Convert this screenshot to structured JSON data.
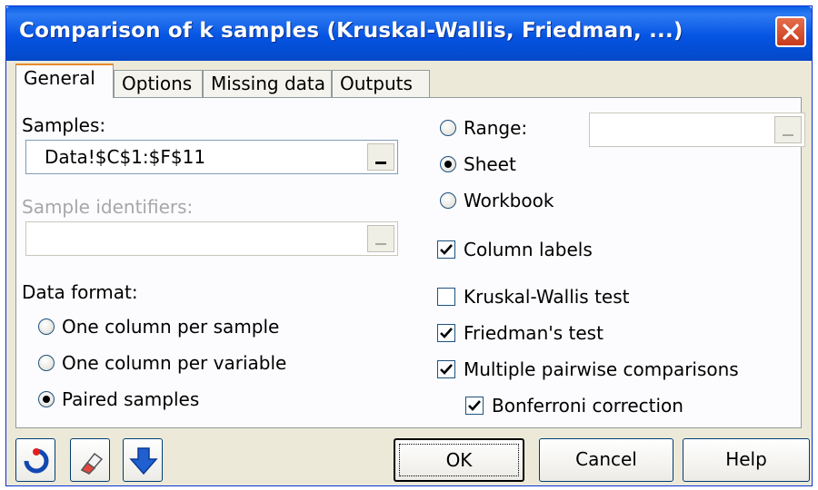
{
  "window": {
    "title": "Comparison of k samples (Kruskal-Wallis, Friedman, ...)"
  },
  "tabs": [
    "General",
    "Options",
    "Missing data",
    "Outputs"
  ],
  "general": {
    "samples_label": "Samples:",
    "samples_value": "Data!$C$1:$F$11",
    "sample_identifiers_label": "Sample identifiers:",
    "sample_identifiers_value": "",
    "data_format_label": "Data format:",
    "data_format_options": [
      "One column per sample",
      "One column per variable",
      "Paired samples"
    ],
    "data_format_selected": "Paired samples",
    "output_options": [
      "Range:",
      "Sheet",
      "Workbook"
    ],
    "output_selected": "Sheet",
    "range_value": "",
    "column_labels": {
      "label": "Column labels",
      "checked": true
    },
    "kruskal_wallis": {
      "label": "Kruskal-Wallis test",
      "checked": false
    },
    "friedman": {
      "label": "Friedman's test",
      "checked": true
    },
    "multiple_pairwise": {
      "label": "Multiple pairwise comparisons",
      "checked": true
    },
    "bonferroni": {
      "label": "Bonferroni correction",
      "checked": true
    }
  },
  "buttons": {
    "ok": "OK",
    "cancel": "Cancel",
    "help": "Help"
  },
  "icons": {
    "reset": "reset-icon",
    "eraser": "eraser-icon",
    "down": "arrow-down-icon"
  }
}
